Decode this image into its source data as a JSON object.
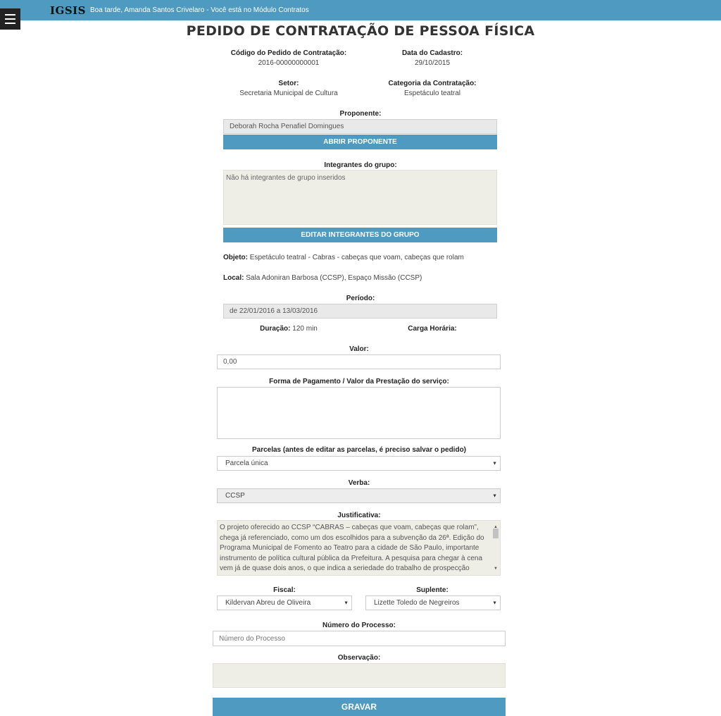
{
  "header": {
    "brand": "IGSIS",
    "greeting": "Boa tarde, Amanda Santos Crivelaro - Você está no Módulo Contratos"
  },
  "page_title": "PEDIDO DE CONTRATAÇÃO DE PESSOA FÍSICA",
  "info": {
    "codigo_label": "Código do Pedido de Contratação:",
    "codigo_value": "2016-00000000001",
    "data_label": "Data do Cadastro:",
    "data_value": "29/10/2015",
    "setor_label": "Setor:",
    "setor_value": "Secretaria Municipal de Cultura",
    "categoria_label": "Categoria da Contratação:",
    "categoria_value": "Espetáculo teatral"
  },
  "proponente": {
    "label": "Proponente:",
    "value": "Deborah Rocha Penafiel Domingues",
    "button": "ABRIR PROPONENTE"
  },
  "integrantes": {
    "label": "Integrantes do grupo:",
    "value": "Não há integrantes de grupo inseridos",
    "button": "EDITAR INTEGRANTES DO GRUPO"
  },
  "objeto": {
    "label": "Objeto:",
    "value": "Espetáculo teatral - Cabras - cabeças que voam, cabeças que rolam"
  },
  "local": {
    "label": "Local:",
    "value": "Sala Adoniran Barbosa (CCSP), Espaço Missão (CCSP)"
  },
  "periodo": {
    "label": "Período:",
    "value": "de 22/01/2016 a 13/03/2016"
  },
  "duracao": {
    "label": "Duração:",
    "value": "120 min"
  },
  "carga": {
    "label": "Carga Horária:",
    "value": ""
  },
  "valor": {
    "label": "Valor:",
    "value": "0,00"
  },
  "forma_pagamento": {
    "label": "Forma de Pagamento / Valor da Prestação do serviço:",
    "value": ""
  },
  "parcelas": {
    "label": "Parcelas (antes de editar as parcelas, é preciso salvar o pedido)",
    "selected": "Parcela única"
  },
  "verba": {
    "label": "Verba:",
    "selected": "CCSP"
  },
  "justificativa": {
    "label": "Justificativa:",
    "value": "O projeto oferecido ao CCSP “CABRAS – cabeças que voam, cabeças que rolam”,  chega já referenciado, como um dos escolhidos para a subvenção da 26ª. Edição do  Programa Municipal de Fomento ao Teatro para a cidade de São Paulo, importante instrumento de política cultural pública da Prefeitura. A pesquisa para chegar à cena vem já de quase dois anos, o que indica a seriedade do trabalho de prospecção estética que é marca do grupo."
  },
  "fiscal": {
    "label": "Fiscal:",
    "selected": "Kildervan Abreu de Oliveira"
  },
  "suplente": {
    "label": "Suplente:",
    "selected": "Lizette Toledo de Negreiros"
  },
  "numero_processo": {
    "label": "Número do Processo:",
    "placeholder": "Número do Processo"
  },
  "observacao": {
    "label": "Observação:",
    "value": ""
  },
  "gravar_button": "GRAVAR",
  "icons": {
    "menu": "hamburger-icon",
    "dropdown": "caret-down-icon"
  },
  "colors": {
    "accent": "#4e9ac0",
    "readonly": "#e9e9e9",
    "textarea": "#eeede6"
  }
}
